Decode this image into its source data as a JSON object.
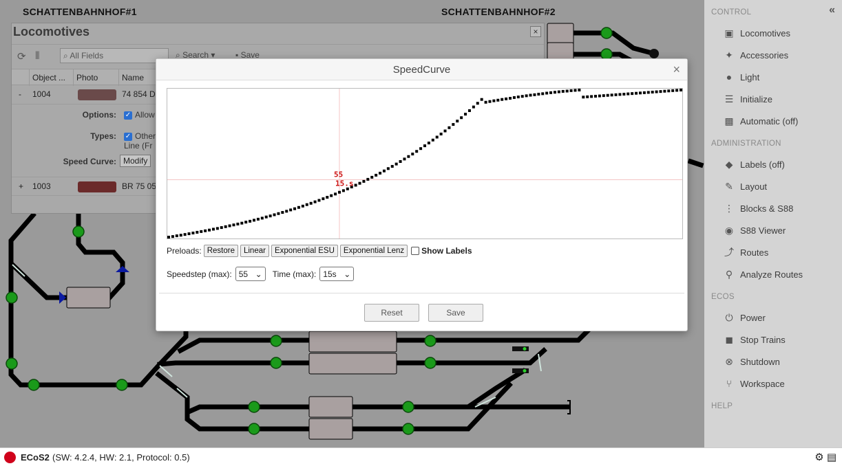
{
  "layout": {
    "station_1": "SCHATTENBAHNHOF#1",
    "station_2": "SCHATTENBAHNHOF#2"
  },
  "loco_panel": {
    "title": "Locomotives",
    "close": "×",
    "search_placeholder": "All Fields",
    "search_button": "Search",
    "save_button": "Save",
    "columns": [
      "Object ...",
      "Photo",
      "Name"
    ],
    "rows": [
      {
        "toggle": "-",
        "id": "1004",
        "name": "74 854 D"
      },
      {
        "toggle": "+",
        "id": "1003",
        "name": "BR 75 05"
      }
    ],
    "options_label": "Options:",
    "options_value": "Allow",
    "types_label": "Types:",
    "types_value_1": "Other",
    "types_value_2": "Line (Fr",
    "speed_curve_label": "Speed Curve:",
    "modify_button": "Modify"
  },
  "sidebar": {
    "sections": [
      {
        "title": "CONTROL",
        "items": [
          {
            "label": "Locomotives",
            "icon": "train-icon"
          },
          {
            "label": "Accessories",
            "icon": "magic-wand-icon"
          },
          {
            "label": "Light",
            "icon": "lightbulb-icon"
          },
          {
            "label": "Initialize",
            "icon": "checklist-icon"
          },
          {
            "label": "Automatic (off)",
            "icon": "robot-icon"
          }
        ]
      },
      {
        "title": "ADMINISTRATION",
        "items": [
          {
            "label": "Labels (off)",
            "icon": "tags-icon"
          },
          {
            "label": "Layout",
            "icon": "edit-icon"
          },
          {
            "label": "Blocks & S88",
            "icon": "traffic-light-icon"
          },
          {
            "label": "S88 Viewer",
            "icon": "viewer-icon"
          },
          {
            "label": "Routes",
            "icon": "route-icon"
          },
          {
            "label": "Analyze Routes",
            "icon": "analyze-icon"
          }
        ]
      },
      {
        "title": "ECOS",
        "items": [
          {
            "label": "Power",
            "icon": "power-icon"
          },
          {
            "label": "Stop Trains",
            "icon": "stop-icon"
          },
          {
            "label": "Shutdown",
            "icon": "shutdown-icon"
          },
          {
            "label": "Workspace",
            "icon": "workspace-icon"
          }
        ]
      },
      {
        "title": "HELP",
        "items": []
      }
    ]
  },
  "dialog": {
    "title": "SpeedCurve",
    "close": "×",
    "preloads_label": "Preloads:",
    "preload_buttons": [
      "Restore",
      "Linear",
      "Exponential ESU",
      "Exponential Lenz"
    ],
    "show_labels": "Show Labels",
    "speedstep_label": "Speedstep (max):",
    "speedstep_value": "55",
    "time_label": "Time (max):",
    "time_value": "15s",
    "reset_button": "Reset",
    "save_button": "Save"
  },
  "chart_data": {
    "type": "scatter",
    "cursor_labels": [
      "55",
      "15.s"
    ],
    "cursor_x": 42,
    "cursor_y": 0.39,
    "xlim": [
      0,
      126
    ],
    "ylim": [
      0,
      1
    ],
    "x": [
      0,
      1,
      2,
      3,
      4,
      5,
      6,
      7,
      8,
      9,
      10,
      11,
      12,
      13,
      14,
      15,
      16,
      17,
      18,
      19,
      20,
      21,
      22,
      23,
      24,
      25,
      26,
      27,
      28,
      29,
      30,
      31,
      32,
      33,
      34,
      35,
      36,
      37,
      38,
      39,
      40,
      41,
      42,
      43,
      44,
      45,
      46,
      47,
      48,
      49,
      50,
      51,
      52,
      53,
      54,
      55,
      56,
      57,
      58,
      59,
      60,
      61,
      62,
      63,
      64,
      65,
      66,
      67,
      68,
      69,
      70,
      71,
      72,
      73,
      74,
      75,
      76,
      77,
      78,
      79,
      80,
      81,
      82,
      83,
      84,
      85,
      86,
      87,
      88,
      89,
      90,
      91,
      92,
      93,
      94,
      95,
      96,
      97,
      98,
      99,
      100,
      101,
      102,
      103,
      104,
      105,
      106,
      107,
      108,
      109,
      110,
      111,
      112,
      113,
      114,
      115,
      116,
      117,
      118,
      119,
      120,
      121,
      122,
      123,
      124,
      125,
      126
    ],
    "y": [
      0.0,
      0.004,
      0.009,
      0.013,
      0.018,
      0.023,
      0.028,
      0.033,
      0.038,
      0.043,
      0.048,
      0.054,
      0.059,
      0.065,
      0.071,
      0.077,
      0.083,
      0.089,
      0.095,
      0.102,
      0.108,
      0.115,
      0.122,
      0.129,
      0.137,
      0.144,
      0.152,
      0.16,
      0.168,
      0.176,
      0.185,
      0.193,
      0.202,
      0.211,
      0.221,
      0.23,
      0.24,
      0.25,
      0.261,
      0.271,
      0.282,
      0.293,
      0.305,
      0.316,
      0.328,
      0.341,
      0.353,
      0.366,
      0.379,
      0.393,
      0.407,
      0.421,
      0.435,
      0.45,
      0.466,
      0.481,
      0.497,
      0.514,
      0.531,
      0.548,
      0.565,
      0.583,
      0.602,
      0.621,
      0.64,
      0.66,
      0.68,
      0.701,
      0.722,
      0.744,
      0.766,
      0.789,
      0.812,
      0.836,
      0.86,
      0.885,
      0.91,
      0.936,
      0.917,
      0.922,
      0.927,
      0.931,
      0.936,
      0.94,
      0.944,
      0.949,
      0.953,
      0.957,
      0.961,
      0.965,
      0.968,
      0.972,
      0.975,
      0.979,
      0.982,
      0.985,
      0.988,
      0.991,
      0.993,
      0.996,
      0.998,
      1.0,
      0.952,
      0.954,
      0.956,
      0.958,
      0.96,
      0.962,
      0.964,
      0.966,
      0.968,
      0.97,
      0.972,
      0.974,
      0.976,
      0.978,
      0.98,
      0.982,
      0.984,
      0.986,
      0.988,
      0.99,
      0.992,
      0.994,
      0.996,
      0.998,
      1.0
    ]
  },
  "statusbar": {
    "name": "ECoS2",
    "info": "(SW: 4.2.4, HW: 2.1, Protocol: 0.5)"
  }
}
